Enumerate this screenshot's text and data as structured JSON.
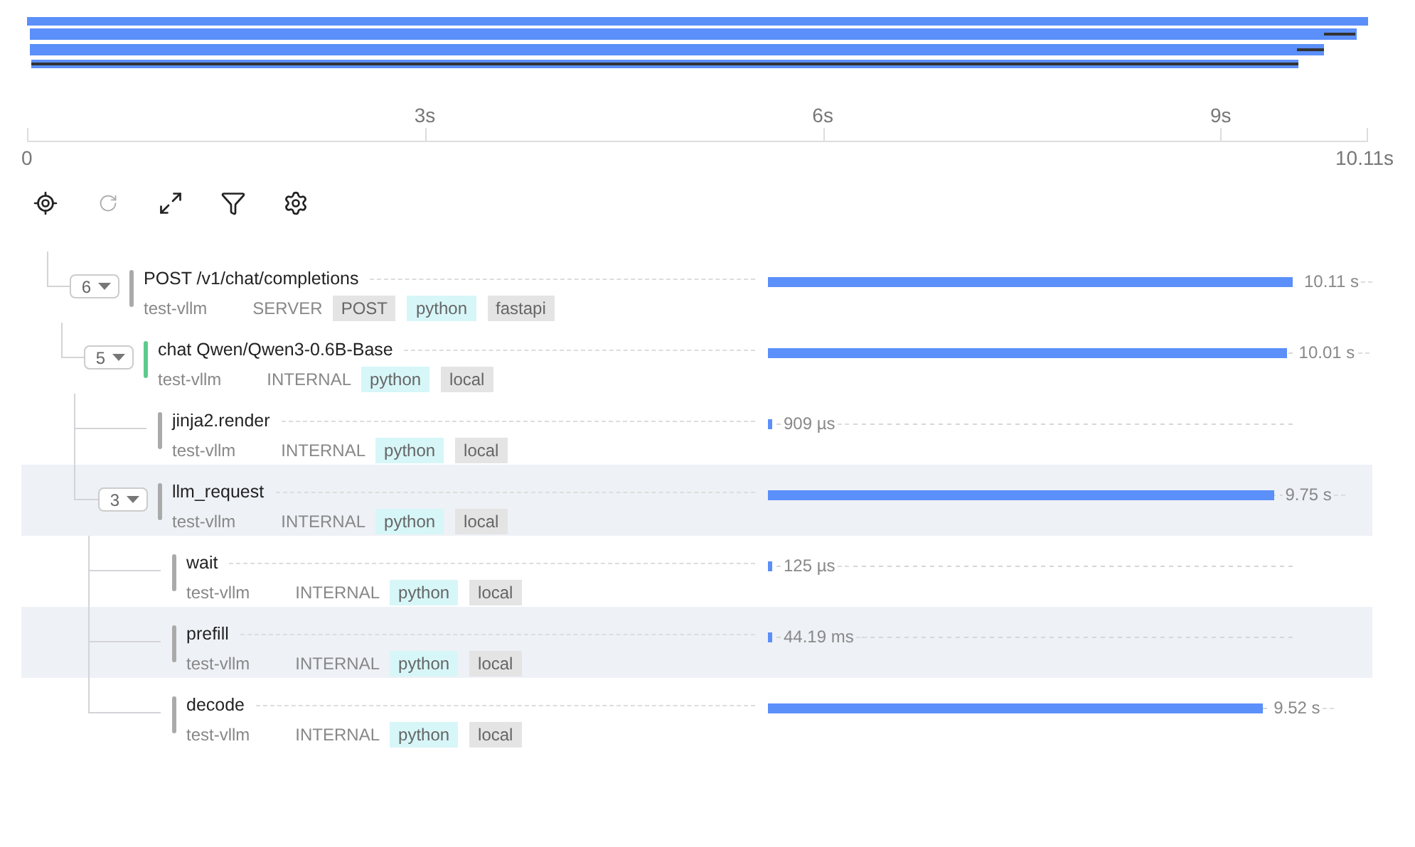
{
  "axis": {
    "start": "0",
    "ticks": [
      "3s",
      "6s",
      "9s"
    ],
    "end": "10.11s"
  },
  "toolbar": [
    {
      "kind": "locate",
      "disabled": false
    },
    {
      "kind": "refresh",
      "disabled": true
    },
    {
      "kind": "expand",
      "disabled": false
    },
    {
      "kind": "filter",
      "disabled": false
    },
    {
      "kind": "settings",
      "disabled": false
    }
  ],
  "spans": [
    {
      "name": "POST /v1/chat/completions",
      "service": "test-vllm",
      "span_kind": "SERVER",
      "color": "#aaaaaa",
      "highlighted": false,
      "count": "6",
      "expanded": true,
      "tags": [
        {
          "label": "POST",
          "color": "#e4e4e4"
        },
        {
          "label": "python",
          "color": "#d7f6f8"
        },
        {
          "label": "fastapi",
          "color": "#e4e4e4"
        }
      ],
      "level": 1,
      "duration": "10.11 s",
      "children": [
        {
          "name": "chat Qwen/Qwen3-0.6B-Base",
          "service": "test-vllm",
          "span_kind": "INTERNAL",
          "color": "#5ccb8c",
          "highlighted": false,
          "count": "5",
          "expanded": true,
          "tags": [
            {
              "label": "python",
              "color": "#d7f6f8"
            },
            {
              "label": "local",
              "color": "#e4e4e4"
            }
          ],
          "level": 0.99,
          "duration": "10.01 s",
          "children": [
            {
              "name": "jinja2.render",
              "service": "test-vllm",
              "span_kind": "INTERNAL",
              "color": "#aaaaaa",
              "highlighted": false,
              "tags": [
                {
                  "label": "python",
                  "color": "#d7f6f8"
                },
                {
                  "label": "local",
                  "color": "#e4e4e4"
                }
              ],
              "level": 0.0001,
              "duration": "909 µs"
            },
            {
              "name": "llm_request",
              "service": "test-vllm",
              "span_kind": "INTERNAL",
              "color": "#aaaaaa",
              "highlighted": true,
              "count": "3",
              "expanded": true,
              "tags": [
                {
                  "label": "python",
                  "color": "#d7f6f8"
                },
                {
                  "label": "local",
                  "color": "#e4e4e4"
                }
              ],
              "level": 0.964,
              "duration": "9.75 s",
              "children": [
                {
                  "name": "wait",
                  "service": "test-vllm",
                  "span_kind": "INTERNAL",
                  "color": "#aaaaaa",
                  "highlighted": false,
                  "tags": [
                    {
                      "label": "python",
                      "color": "#d7f6f8"
                    },
                    {
                      "label": "local",
                      "color": "#e4e4e4"
                    }
                  ],
                  "level": 0.0001,
                  "duration": "125 µs"
                },
                {
                  "name": "prefill",
                  "service": "test-vllm",
                  "span_kind": "INTERNAL",
                  "color": "#aaaaaa",
                  "highlighted": true,
                  "tags": [
                    {
                      "label": "python",
                      "color": "#d7f6f8"
                    },
                    {
                      "label": "local",
                      "color": "#e4e4e4"
                    }
                  ],
                  "level": 0.0044,
                  "duration": "44.19 ms"
                },
                {
                  "name": "decode",
                  "service": "test-vllm",
                  "span_kind": "INTERNAL",
                  "color": "#aaaaaa",
                  "highlighted": false,
                  "tags": [
                    {
                      "label": "python",
                      "color": "#d7f6f8"
                    },
                    {
                      "label": "local",
                      "color": "#e4e4e4"
                    }
                  ],
                  "level": 0.942,
                  "duration": "9.52 s"
                }
              ]
            }
          ]
        }
      ]
    }
  ]
}
